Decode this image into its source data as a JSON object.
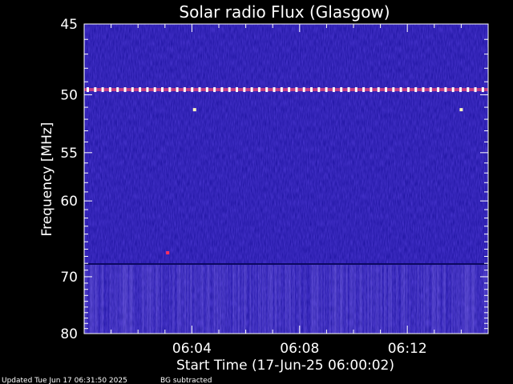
{
  "chart_data": {
    "type": "heatmap",
    "title": "Solar radio Flux (Glasgow)",
    "xlabel": "Start Time (17-Jun-25 06:00:02)",
    "ylabel": "Frequency [MHz]",
    "x_range_minutes": [
      0,
      15
    ],
    "x_tick_values_minutes": [
      4,
      8,
      12
    ],
    "x_tick_labels": [
      "06:04",
      "06:08",
      "06:12"
    ],
    "y_range_mhz": [
      45,
      80
    ],
    "y_scale": "reciprocal",
    "y_tick_values": [
      45,
      50,
      55,
      60,
      70,
      80
    ],
    "y_tick_labels": [
      "45",
      "50",
      "55",
      "60",
      "70",
      "80"
    ],
    "colormap": [
      "#1a0f9a",
      "#2a1fd0",
      "#3b3bff",
      "#7a5cff",
      "#ff3060",
      "#ffffff"
    ],
    "background_color": "#1a109c",
    "features": [
      {
        "kind": "interference-line",
        "freq_mhz": 49.6,
        "minutes": [
          0,
          15
        ]
      },
      {
        "kind": "spot",
        "freq_mhz": 51.2,
        "minute": 4.1
      },
      {
        "kind": "spot",
        "freq_mhz": 51.2,
        "minute": 14.0
      },
      {
        "kind": "spot",
        "freq_mhz": 66.5,
        "minute": 3.1
      }
    ]
  },
  "footer": {
    "updated": "Updated Tue Jun 17 06:31:50 2025",
    "note": "BG subtracted"
  }
}
